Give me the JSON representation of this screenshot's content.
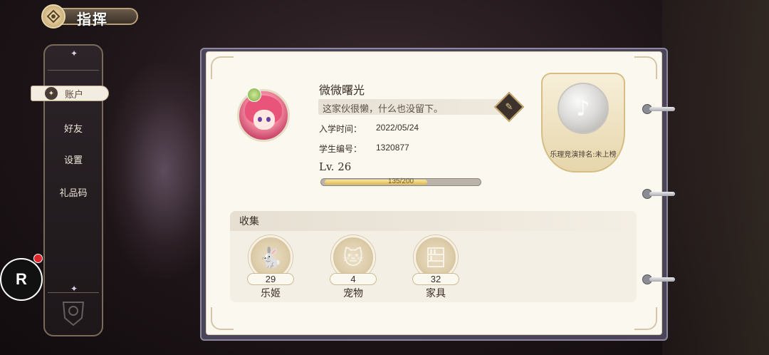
{
  "header": {
    "title": "指挥"
  },
  "sidebar": {
    "items": [
      {
        "label": "账户",
        "active": true
      },
      {
        "label": "好友"
      },
      {
        "label": "设置"
      },
      {
        "label": "礼品码"
      }
    ]
  },
  "floating_button": {
    "label": "R"
  },
  "profile": {
    "name": "微微曙光",
    "signature": "这家伙很懒，什么也没留下。",
    "enroll_label": "入学时间：",
    "enroll_date": "2022/05/24",
    "student_id_label": "学生编号：",
    "student_id": "1320877",
    "level_text": "Lv. 26",
    "xp_text": "135/200",
    "xp_current": 135,
    "xp_max": 200
  },
  "rank": {
    "label": "乐理竞演排名:未上榜"
  },
  "collection": {
    "title": "收集",
    "items": [
      {
        "count": "29",
        "label": "乐姬",
        "icon": "bunny-icon"
      },
      {
        "count": "4",
        "label": "宠物",
        "icon": "lucky-cat-icon"
      },
      {
        "count": "32",
        "label": "家具",
        "icon": "bookshelf-icon"
      }
    ]
  },
  "colors": {
    "accent": "#c4a66c",
    "page": "#fbf8ef",
    "frame": "#4a4558"
  }
}
